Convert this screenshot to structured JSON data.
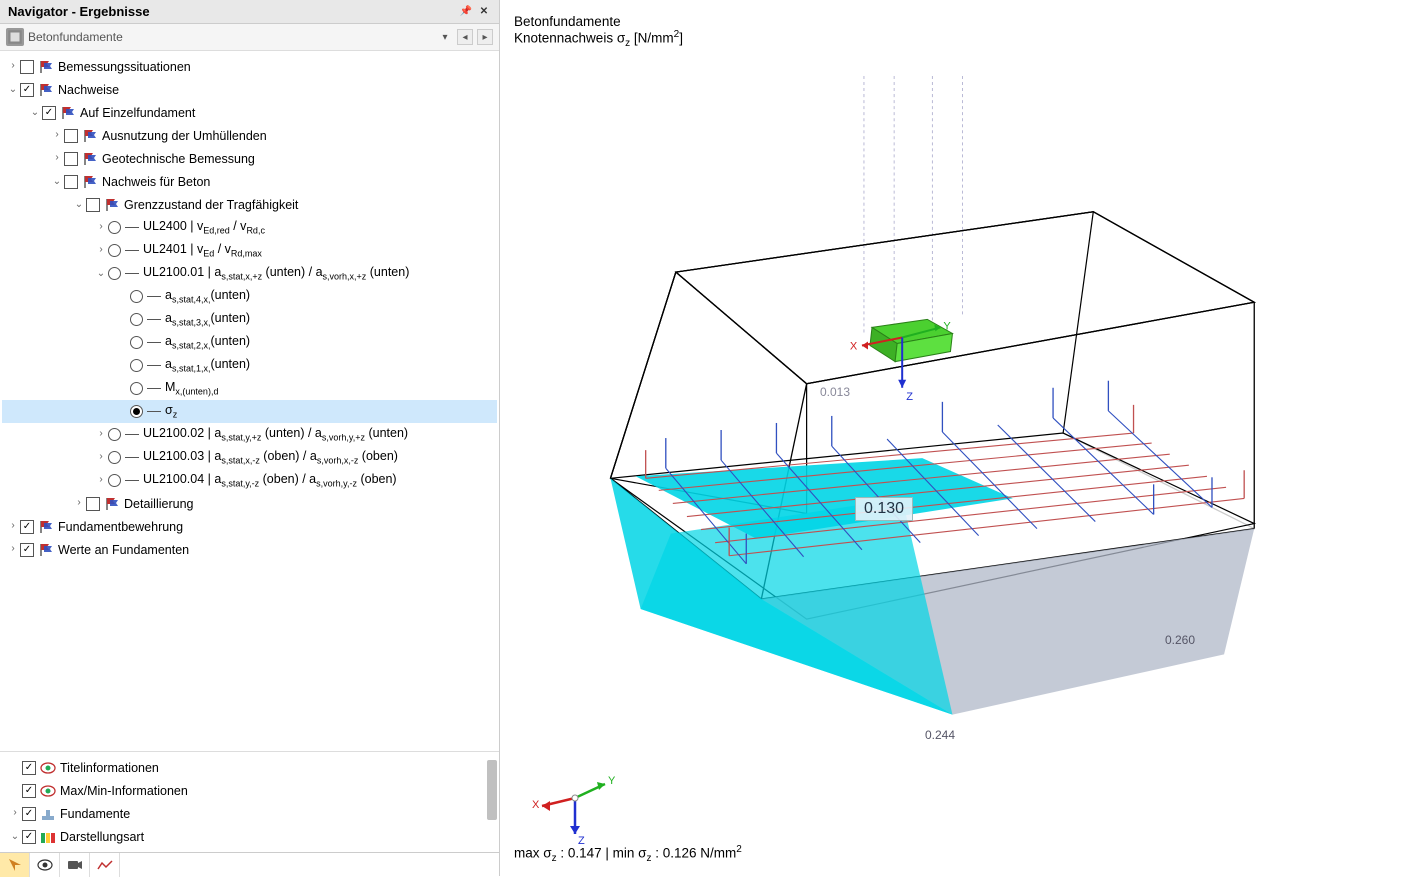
{
  "panel": {
    "title": "Navigator - Ergebnisse"
  },
  "breadcrumb": {
    "text": "Betonfundamente"
  },
  "tree": [
    {
      "indent": 0,
      "exp": "closed",
      "check": "unchecked",
      "icon": "flag",
      "label": "Bemessungssituationen"
    },
    {
      "indent": 0,
      "exp": "open",
      "check": "checked",
      "icon": "flag",
      "label": "Nachweise"
    },
    {
      "indent": 1,
      "exp": "open",
      "check": "checked",
      "icon": "flag",
      "label": "Auf Einzelfundament"
    },
    {
      "indent": 2,
      "exp": "closed",
      "check": "unchecked",
      "icon": "flag",
      "label": "Ausnutzung der Umhüllenden"
    },
    {
      "indent": 2,
      "exp": "closed",
      "check": "unchecked",
      "icon": "flag",
      "label": "Geotechnische Bemessung"
    },
    {
      "indent": 2,
      "exp": "open",
      "check": "unchecked",
      "icon": "flag",
      "label": "Nachweis für Beton"
    },
    {
      "indent": 3,
      "exp": "open",
      "check": "unchecked",
      "icon": "flag",
      "label": "Grenzzustand der Tragfähigkeit"
    },
    {
      "indent": 4,
      "exp": "closed",
      "radio": "off",
      "icon": "dash",
      "label": "UL2400 | v<sub>Ed,red</sub> / v<sub>Rd,c</sub>"
    },
    {
      "indent": 4,
      "exp": "closed",
      "radio": "off",
      "icon": "dash",
      "label": "UL2401 | v<sub>Ed</sub> / v<sub>Rd,max</sub>"
    },
    {
      "indent": 4,
      "exp": "open",
      "radio": "off",
      "icon": "dash",
      "label": "UL2100.01 | a<sub>s,stat,x,+z</sub> (unten) / a<sub>s,vorh,x,+z</sub> (unten)"
    },
    {
      "indent": 5,
      "exp": "none",
      "radio": "off",
      "icon": "dash",
      "label": "a<sub>s,stat,4,x,</sub>(unten)"
    },
    {
      "indent": 5,
      "exp": "none",
      "radio": "off",
      "icon": "dash",
      "label": "a<sub>s,stat,3,x,</sub>(unten)"
    },
    {
      "indent": 5,
      "exp": "none",
      "radio": "off",
      "icon": "dash",
      "label": "a<sub>s,stat,2,x,</sub>(unten)"
    },
    {
      "indent": 5,
      "exp": "none",
      "radio": "off",
      "icon": "dash",
      "label": "a<sub>s,stat,1,x,</sub>(unten)"
    },
    {
      "indent": 5,
      "exp": "none",
      "radio": "off",
      "icon": "dash",
      "label": "M<sub>x,(unten),d</sub>"
    },
    {
      "indent": 5,
      "exp": "none",
      "radio": "on",
      "icon": "dash",
      "label": "σ<sub>z</sub>",
      "selected": true
    },
    {
      "indent": 4,
      "exp": "closed",
      "radio": "off",
      "icon": "dash",
      "label": "UL2100.02 | a<sub>s,stat,y,+z</sub> (unten) / a<sub>s,vorh,y,+z</sub> (unten)"
    },
    {
      "indent": 4,
      "exp": "closed",
      "radio": "off",
      "icon": "dash",
      "label": "UL2100.03 | a<sub>s,stat,x,-z</sub> (oben) / a<sub>s,vorh,x,-z</sub> (oben)"
    },
    {
      "indent": 4,
      "exp": "closed",
      "radio": "off",
      "icon": "dash",
      "label": "UL2100.04 | a<sub>s,stat,y,-z</sub> (oben) / a<sub>s,vorh,y,-z</sub> (oben)"
    },
    {
      "indent": 3,
      "exp": "closed",
      "check": "unchecked",
      "icon": "flag",
      "label": "Detaillierung"
    },
    {
      "indent": 0,
      "exp": "closed",
      "check": "checked",
      "icon": "flag",
      "label": "Fundamentbewehrung"
    },
    {
      "indent": 0,
      "exp": "closed",
      "check": "checked",
      "icon": "flag",
      "label": "Werte an Fundamenten"
    }
  ],
  "subopts": [
    {
      "exp": "none",
      "check": "checked",
      "icon": "eye",
      "label": "Titelinformationen"
    },
    {
      "exp": "none",
      "check": "checked",
      "icon": "eye",
      "label": "Max/Min-Informationen"
    },
    {
      "exp": "closed",
      "check": "checked",
      "icon": "fund",
      "label": "Fundamente"
    },
    {
      "exp": "open",
      "check": "checked",
      "icon": "color",
      "label": "Darstellungsart"
    }
  ],
  "viewport": {
    "title_line1": "Betonfundamente",
    "title_line2_prefix": "Knotennachweis σ",
    "title_line2_sub": "z",
    "title_line2_suffix": " [N/mm",
    "title_line2_sup": "2",
    "title_line2_end": "]",
    "tooltip": "0.130",
    "val1": "0.013",
    "val2": "0.260",
    "val3": "0.244",
    "axes": {
      "x": "X",
      "y": "Y",
      "z": "Z"
    },
    "model_axes": {
      "x": "X",
      "y": "Y",
      "z": "Z"
    },
    "footer_prefix": "max σ",
    "footer_sub1": "z",
    "footer_mid": " : 0.147 | min σ",
    "footer_sub2": "z",
    "footer_end": " : 0.126 N/mm",
    "footer_sup": "2"
  }
}
